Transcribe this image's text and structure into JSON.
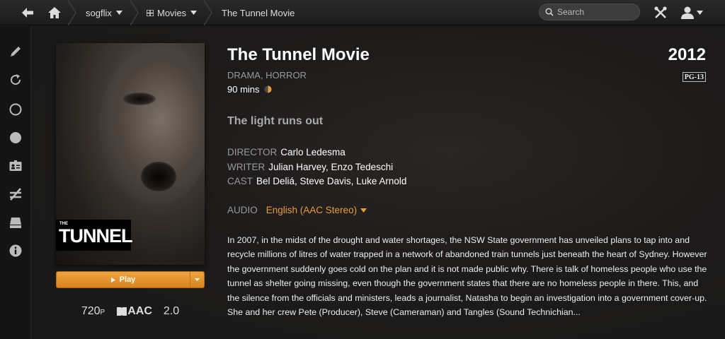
{
  "topbar": {
    "breadcrumbs": [
      "sogflix",
      "Movies",
      "The Tunnel Movie"
    ],
    "search_placeholder": "Search"
  },
  "sidebar": {
    "items": [
      "pencil-icon",
      "refresh-icon",
      "circle-outline-icon",
      "circle-filled-icon",
      "id-card-icon",
      "unwatched-icon",
      "drive-icon",
      "info-icon"
    ]
  },
  "movie": {
    "title": "The Tunnel Movie",
    "year": "2012",
    "rating": "PG-13",
    "genres": "DRAMA, HORROR",
    "duration": "90 mins",
    "tagline": "The light runs out",
    "director_label": "DIRECTOR",
    "director": "Carlo Ledesma",
    "writer_label": "WRITER",
    "writer": "Julian Harvey, Enzo Tedeschi",
    "cast_label": "CAST",
    "cast": "Bel Deliá, Steve Davis, Luke Arnold",
    "audio_label": "AUDIO",
    "audio": "English (AAC Stereo)",
    "summary": "In 2007, in the midst of the drought and water shortages, the NSW State government has unveiled plans to tap into and recycle millions of litres of water trapped in a network of abandoned train tunnels just beneath the heart of Sydney. However the government suddenly goes cold on the plan and it is not made public why. There is talk of homeless people who use the tunnel as shelter going missing, even though the government states that there are no homeless people in there. This, and the silence from the officials and ministers, leads a journalist, Natasha to begin an investigation into a government cover-up. She and her crew Pete (Producer), Steve (Cameraman) and Tangles (Sound Technichian..."
  },
  "poster": {
    "logo_small": "THE",
    "logo_big": "TUNNEL"
  },
  "play": {
    "label": "Play"
  },
  "media": {
    "resolution": "720",
    "resolution_suffix": "P",
    "codec": "AAC",
    "channels": "2.0"
  },
  "colors": {
    "accent": "#e99c36",
    "background": "#1b1b1b"
  }
}
